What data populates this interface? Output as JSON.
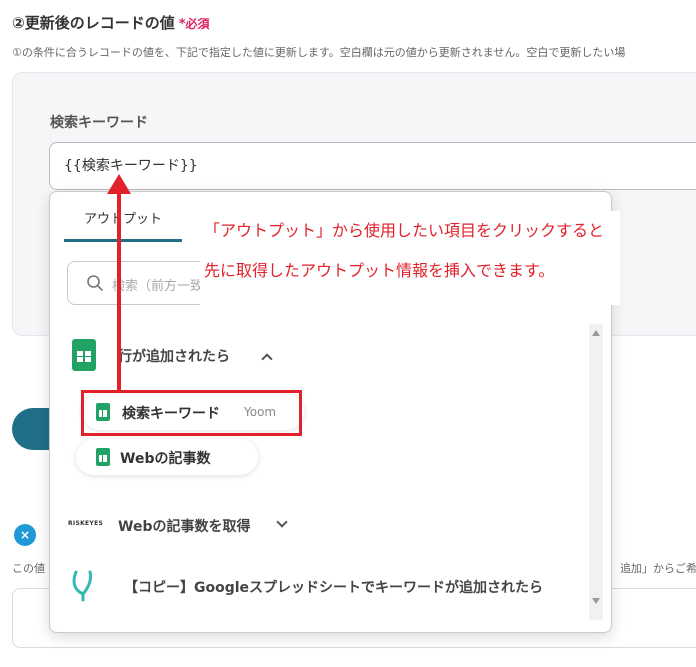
{
  "section": {
    "title": "②更新後のレコードの値",
    "required_mark": "*",
    "required_label": "必須",
    "description": "①の条件に合うレコードの値を、下記で指定した値に更新します。空白欄は元の値から更新されません。空白で更新したい場"
  },
  "field": {
    "label": "検索キーワード",
    "value": "{{検索キーワード}}"
  },
  "dropdown": {
    "tab_label": "アウトプット",
    "tab_separator": "|",
    "search_placeholder": "検索（前方一致）",
    "groups": [
      {
        "title": "行が追加されたら",
        "icon": "google-sheets-icon",
        "expanded": true,
        "items": [
          {
            "label": "検索キーワード",
            "source": "Yoom"
          },
          {
            "label": "Webの記事数"
          }
        ]
      },
      {
        "title": "Webの記事数を取得",
        "icon": "riskeyes-logo",
        "logo_text": "RISKEYES",
        "expanded": false
      },
      {
        "title": "【コピー】Googleスプレッドシートでキーワードが追加されたら",
        "icon": "yoom-flow-icon"
      }
    ]
  },
  "background": {
    "text_a": "この値",
    "text_b": "追加」からご希望"
  },
  "annotation": {
    "line1": "「アウトプット」から使用したい項目をクリックすると",
    "line2": "先に取得したアウトプット情報を挿入できます。",
    "color": "#e1222a"
  },
  "colors": {
    "accent": "#1f6f86",
    "sheets_green": "#21a366",
    "required": "#e0245e"
  }
}
